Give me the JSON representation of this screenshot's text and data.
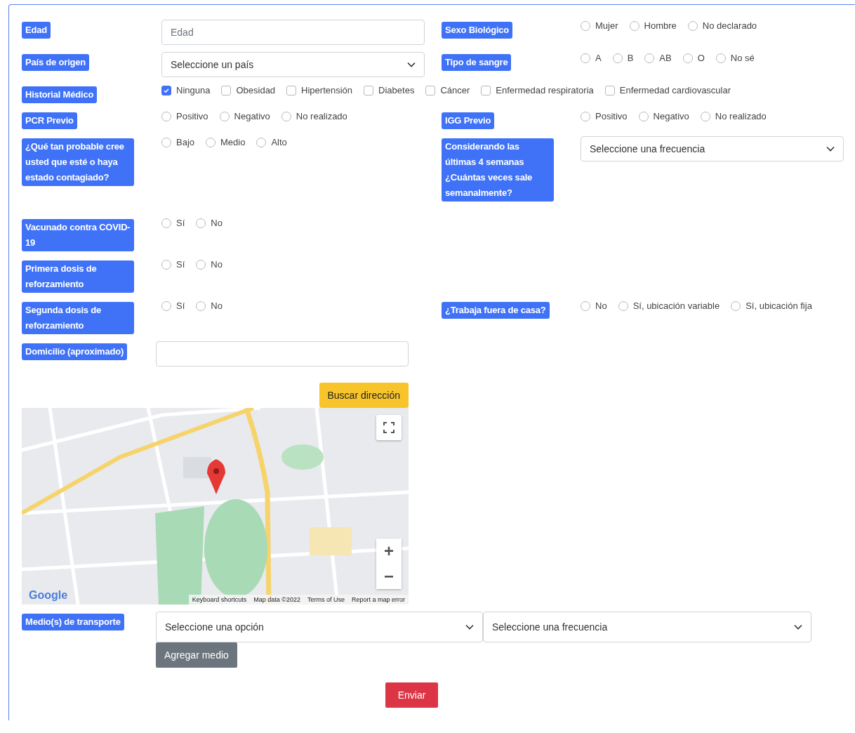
{
  "form": {
    "rows": [
      {
        "left": {
          "label": "Edad",
          "control": {
            "kind": "text",
            "placeholder": "Edad"
          }
        },
        "right": {
          "label": "Sexo Biológico",
          "control": {
            "kind": "radios",
            "options": [
              {
                "label": "Mujer",
                "selected": false
              },
              {
                "label": "Hombre",
                "selected": false
              },
              {
                "label": "No declarado",
                "selected": false
              }
            ]
          }
        }
      },
      {
        "left": {
          "label": "País de origen",
          "control": {
            "kind": "select",
            "value": "Seleccione un país"
          }
        },
        "right": {
          "label": "Tipo de sangre",
          "control": {
            "kind": "radios",
            "options": [
              {
                "label": "A",
                "selected": false
              },
              {
                "label": "B",
                "selected": false
              },
              {
                "label": "AB",
                "selected": false
              },
              {
                "label": "O",
                "selected": false
              },
              {
                "label": "No sé",
                "selected": false
              }
            ]
          }
        }
      },
      {
        "left": {
          "label": "Historial Médico",
          "control": {
            "kind": "checks",
            "options": [
              {
                "label": "Ninguna",
                "checked": true
              },
              {
                "label": "Obesidad",
                "checked": false
              },
              {
                "label": "Hipertensión",
                "checked": false
              },
              {
                "label": "Diabetes",
                "checked": false
              },
              {
                "label": "Cáncer",
                "checked": false
              },
              {
                "label": "Enfermedad respiratoria",
                "checked": false
              },
              {
                "label": "Enfermedad cardiovascular",
                "checked": false
              }
            ]
          }
        }
      },
      {
        "left": {
          "label": "PCR Previo",
          "control": {
            "kind": "radios",
            "options": [
              {
                "label": "Positivo",
                "selected": false
              },
              {
                "label": "Negativo",
                "selected": false
              },
              {
                "label": "No realizado",
                "selected": false
              }
            ]
          }
        },
        "right": {
          "label": "IGG Previo",
          "control": {
            "kind": "radios",
            "options": [
              {
                "label": "Positivo",
                "selected": false
              },
              {
                "label": "Negativo",
                "selected": false
              },
              {
                "label": "No realizado",
                "selected": false
              }
            ]
          }
        }
      },
      {
        "left": {
          "label": "¿Qué tan probable cree usted que esté o haya estado contagiado?",
          "control": {
            "kind": "radios",
            "options": [
              {
                "label": "Bajo",
                "selected": false
              },
              {
                "label": "Medio",
                "selected": false
              },
              {
                "label": "Alto",
                "selected": false
              }
            ]
          }
        },
        "right": {
          "label": "Considerando las últimas 4 semanas ¿Cuántas veces sale semanalmente?",
          "control": {
            "kind": "select",
            "value": "Seleccione una frecuencia"
          }
        }
      },
      {
        "left": {
          "label": "Vacunado contra COVID-19",
          "control": {
            "kind": "radios",
            "options": [
              {
                "label": "Sí",
                "selected": false
              },
              {
                "label": "No",
                "selected": false
              }
            ]
          }
        }
      },
      {
        "left": {
          "label": "Primera dosis de reforzamiento",
          "control": {
            "kind": "radios",
            "options": [
              {
                "label": "Sí",
                "selected": false
              },
              {
                "label": "No",
                "selected": false
              }
            ]
          }
        }
      },
      {
        "left": {
          "label": "Segunda dosis de reforzamiento",
          "control": {
            "kind": "radios",
            "options": [
              {
                "label": "Sí",
                "selected": false
              },
              {
                "label": "No",
                "selected": false
              }
            ]
          }
        },
        "right": {
          "label": "¿Trabaja fuera de casa?",
          "control": {
            "kind": "radios",
            "options": [
              {
                "label": "No",
                "selected": false
              },
              {
                "label": "Sí, ubicación variable",
                "selected": false
              },
              {
                "label": "Sí, ubicación fija",
                "selected": false
              }
            ]
          }
        }
      },
      {
        "left": {
          "label": "Domicilio (aproximado)",
          "control": {
            "kind": "address",
            "button": "Buscar dirección",
            "map": {
              "kind": "picture",
              "zoom_in": "+",
              "zoom_out": "−",
              "logo": "Google",
              "attribution": [
                "Keyboard shortcuts",
                "Map data ©2022",
                "Terms of Use",
                "Report a map error"
              ]
            }
          }
        }
      },
      {
        "left": {
          "label": "Medio(s) de transporte",
          "control": {
            "kind": "transport",
            "selects": [
              "Seleccione una opción",
              "Seleccione una frecuencia"
            ],
            "button": "Agregar medio"
          }
        }
      }
    ],
    "submit": "Enviar"
  }
}
